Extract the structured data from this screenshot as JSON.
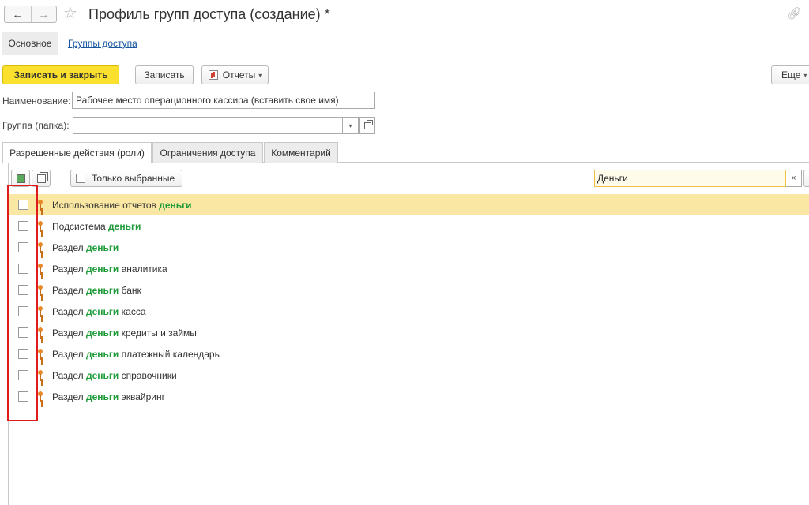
{
  "window": {
    "title": "Профиль групп доступа (создание) *",
    "back_icon": "←",
    "forward_icon": "→",
    "star_icon": "☆",
    "link_icon": "🔗"
  },
  "sections": {
    "main": "Основное",
    "access_groups": "Группы доступа"
  },
  "toolbar": {
    "save_close": "Записать и закрыть",
    "save": "Записать",
    "reports": "Отчеты",
    "more": "Еще",
    "caret": "▾"
  },
  "fields": {
    "name_label": "Наименование:",
    "name_value": "Рабочее место операционного кассира (вставить свое имя)",
    "group_label": "Группа (папка):",
    "group_value": "",
    "dropdown_icon": "▾"
  },
  "tabs": [
    {
      "label": "Разрешенные действия (роли)"
    },
    {
      "label": "Ограничения доступа"
    },
    {
      "label": "Комментарий"
    }
  ],
  "panel": {
    "only_selected": "Только выбранные",
    "search_value": "Деньги",
    "clear_icon": "×",
    "extra_button": "Е"
  },
  "roles": [
    {
      "before": "Использование отчетов ",
      "match": "деньги",
      "after": "",
      "checked": false
    },
    {
      "before": "Подсистема ",
      "match": "деньги",
      "after": "",
      "checked": false
    },
    {
      "before": "Раздел ",
      "match": "деньги",
      "after": "",
      "checked": false
    },
    {
      "before": "Раздел ",
      "match": "деньги",
      "after": " аналитика",
      "checked": false
    },
    {
      "before": "Раздел ",
      "match": "деньги",
      "after": " банк",
      "checked": false
    },
    {
      "before": "Раздел ",
      "match": "деньги",
      "after": " касса",
      "checked": false
    },
    {
      "before": "Раздел ",
      "match": "деньги",
      "after": " кредиты и займы",
      "checked": false
    },
    {
      "before": "Раздел ",
      "match": "деньги",
      "after": " платежный календарь",
      "checked": false
    },
    {
      "before": "Раздел ",
      "match": "деньги",
      "after": " справочники",
      "checked": false
    },
    {
      "before": "Раздел ",
      "match": "деньги",
      "after": " эквайринг",
      "checked": false
    }
  ],
  "colors": {
    "primary_button": "#fbe12d",
    "selected_row": "#f9e7a3",
    "highlight_text": "#1f9b3a",
    "annotation_box": "#e01b1b"
  }
}
